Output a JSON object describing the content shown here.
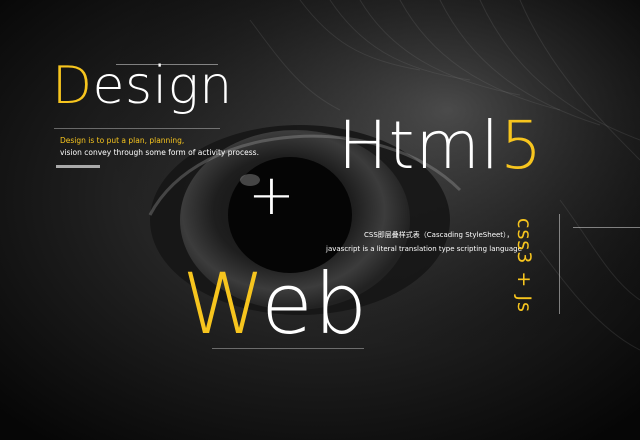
{
  "design": {
    "initial": "D",
    "rest": "esign",
    "subtitle_line1": "Design is to put a plan, planning,",
    "subtitle_line2": "vision convey through some form of activity process."
  },
  "html5": {
    "word": "Html",
    "version": "5"
  },
  "plus": "+",
  "css_description": {
    "line1": "CSS即层叠样式表（Cascading StyleSheet），",
    "line2": "javascript is a literal translation type scripting language"
  },
  "side_text": {
    "css": "css",
    "version": "3",
    "rest": " + Js"
  },
  "web": {
    "initial": "W",
    "rest": "eb"
  },
  "colors": {
    "accent": "#f7c51e",
    "text": "#ffffff",
    "background": "#0c0c0c"
  }
}
